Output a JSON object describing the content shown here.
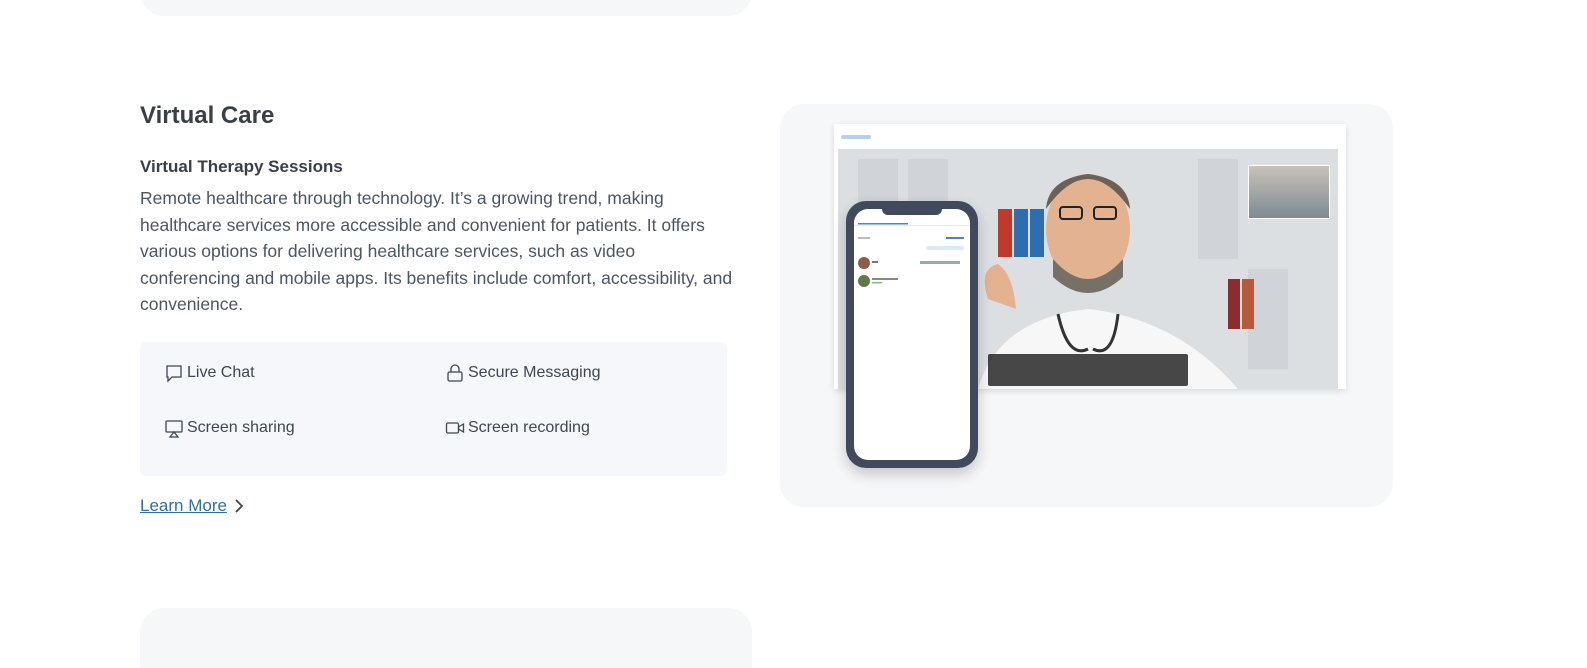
{
  "section": {
    "title": "Virtual Care",
    "subtitle": "Virtual Therapy Sessions",
    "description": "Remote healthcare through technology. It’s a growing trend, making healthcare services more accessible and convenient for patients. It offers various options for delivering healthcare services, such as video conferencing and mobile apps. Its benefits include comfort, accessibility, and convenience."
  },
  "features": [
    {
      "label": "Live Chat",
      "icon": "chat-icon"
    },
    {
      "label": "Secure Messaging",
      "icon": "lock-icon"
    },
    {
      "label": "Screen sharing",
      "icon": "screen-share-icon"
    },
    {
      "label": "Screen recording",
      "icon": "video-camera-icon"
    }
  ],
  "cta": {
    "label": "Learn More",
    "icon": "chevron-right-icon"
  },
  "colors": {
    "link": "#2d6fa6",
    "panel": "#f5f7fa",
    "card": "#f6f7f8",
    "phone_frame": "#414a5c"
  }
}
